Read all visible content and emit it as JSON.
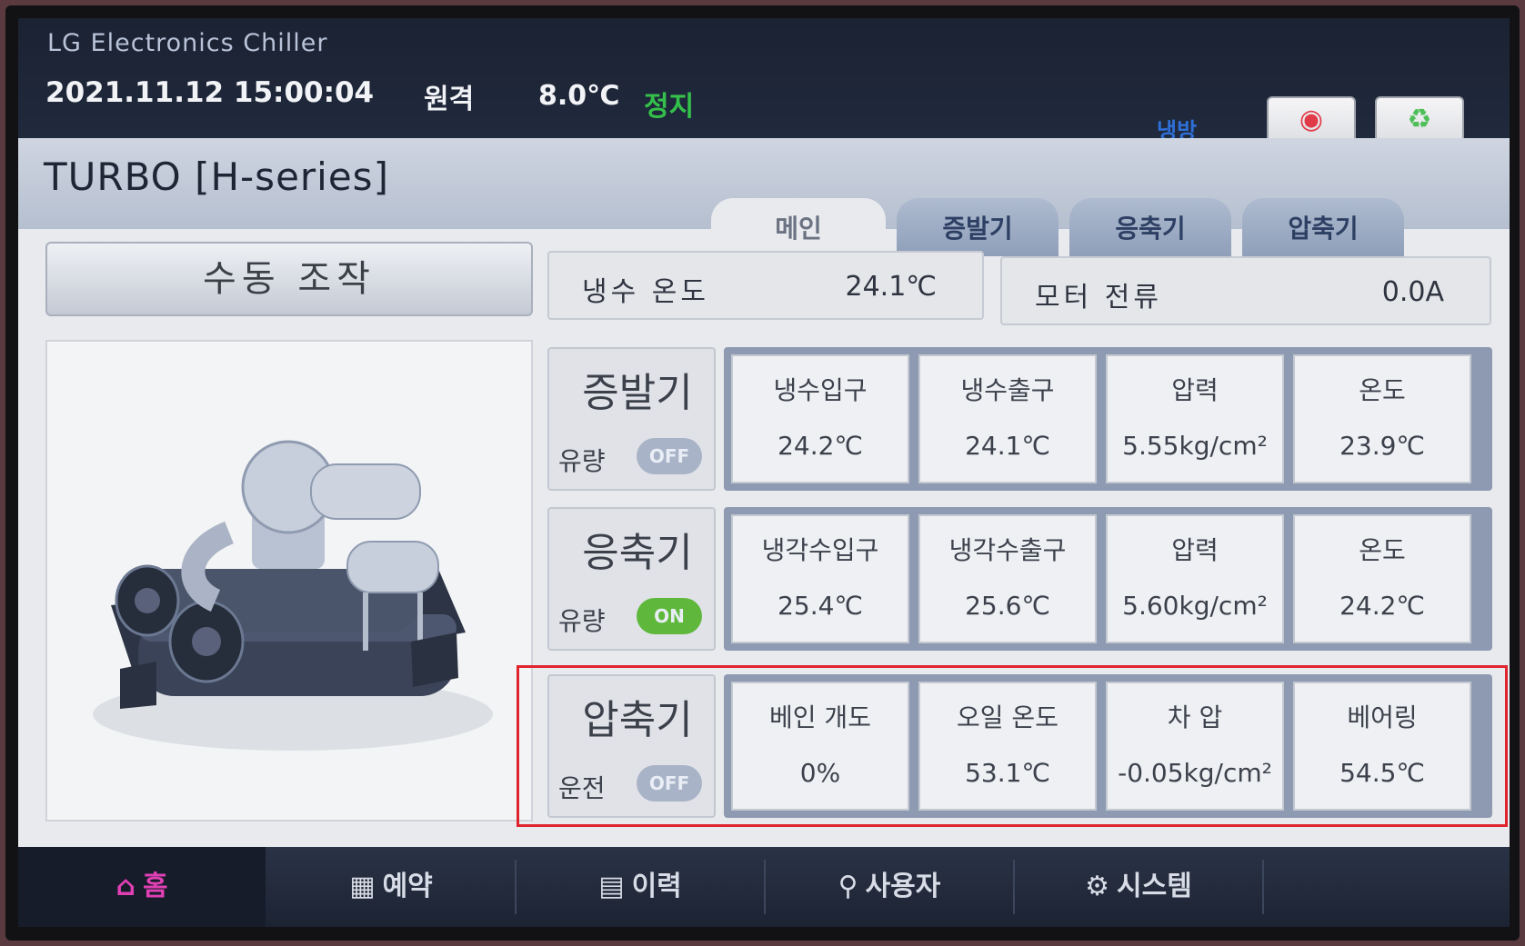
{
  "header": {
    "brand": "LG Electronics Chiller",
    "datetime": "2021.11.12 15:00:04",
    "mode": "원격",
    "temperature": "8.0℃",
    "status": "정지",
    "cool_mode": "냉방",
    "stop_icon": "◉",
    "stop_label": "정지",
    "run_icon": "♻",
    "run_label": "운전"
  },
  "model": "TURBO [H-series]",
  "tabs": [
    "메인",
    "증발기",
    "응축기",
    "압축기"
  ],
  "manual_button": "수동 조작",
  "summary": [
    {
      "label": "냉수 온도",
      "value": "24.1℃"
    },
    {
      "label": "모터 전류",
      "value": "0.0A"
    }
  ],
  "sections": [
    {
      "name": "증발기",
      "flow_label": "유량",
      "flow_state": "OFF",
      "cells": [
        {
          "title": "냉수입구",
          "value": "24.2℃"
        },
        {
          "title": "냉수출구",
          "value": "24.1℃"
        },
        {
          "title": "압력",
          "value": "5.55kg/cm²"
        },
        {
          "title": "온도",
          "value": "23.9℃"
        }
      ]
    },
    {
      "name": "응축기",
      "flow_label": "유량",
      "flow_state": "ON",
      "cells": [
        {
          "title": "냉각수입구",
          "value": "25.4℃"
        },
        {
          "title": "냉각수출구",
          "value": "25.6℃"
        },
        {
          "title": "압력",
          "value": "5.60kg/cm²"
        },
        {
          "title": "온도",
          "value": "24.2℃"
        }
      ]
    },
    {
      "name": "압축기",
      "flow_label": "운전",
      "flow_state": "OFF",
      "cells": [
        {
          "title": "베인 개도",
          "value": "0%"
        },
        {
          "title": "오일 온도",
          "value": "53.1℃"
        },
        {
          "title": "차 압",
          "value": "-0.05kg/cm²"
        },
        {
          "title": "베어링",
          "value": "54.5℃"
        }
      ]
    }
  ],
  "nav": [
    {
      "icon": "⌂",
      "label": "홈"
    },
    {
      "icon": "▦",
      "label": "예약"
    },
    {
      "icon": "▤",
      "label": "이력"
    },
    {
      "icon": "⚲",
      "label": "사용자"
    },
    {
      "icon": "⚙",
      "label": "시스템"
    }
  ],
  "colors": {
    "accent_home": "#e040b3",
    "status_stop": "#34c04b",
    "pill_on": "#5fb83c",
    "pill_off": "#a8b3c7",
    "highlight": "#e0242d"
  }
}
